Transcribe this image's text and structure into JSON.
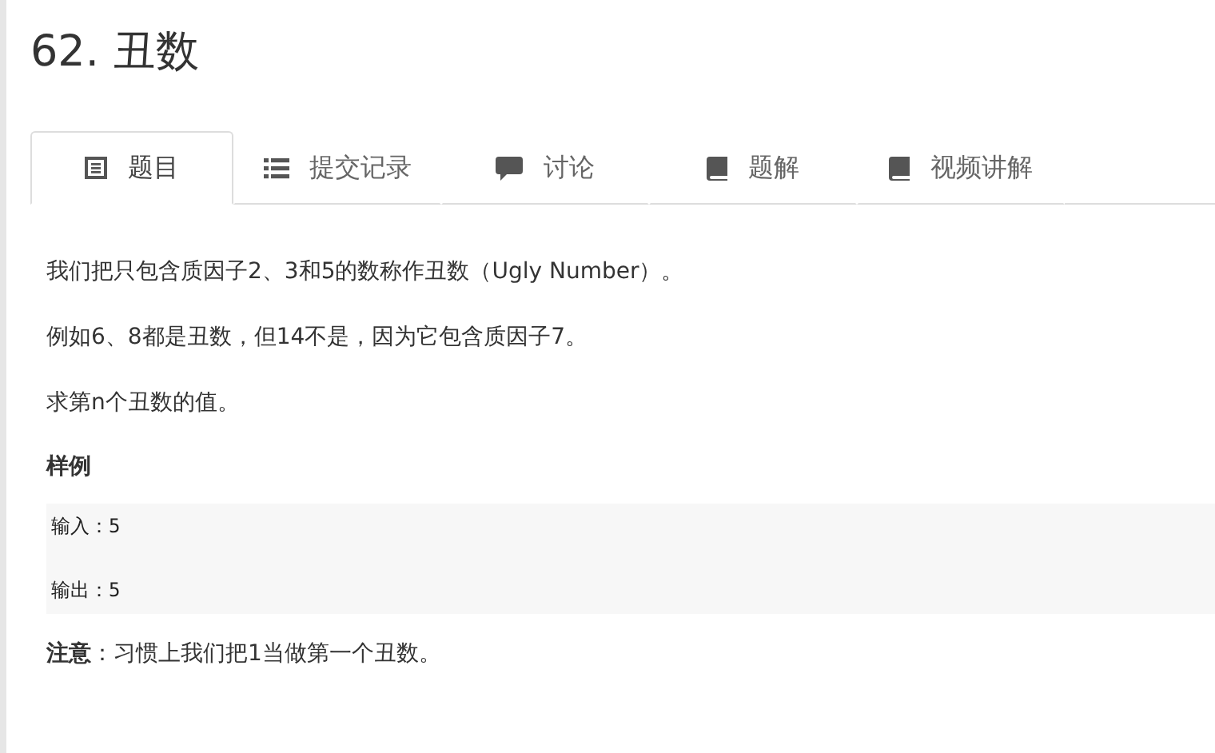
{
  "title": "62. 丑数",
  "tabs": [
    {
      "label": "题目",
      "kind": "doc",
      "selected": true
    },
    {
      "label": "提交记录",
      "kind": "list",
      "selected": false
    },
    {
      "label": "讨论",
      "kind": "comment",
      "selected": false
    },
    {
      "label": "题解",
      "kind": "book",
      "selected": false
    },
    {
      "label": "视频讲解",
      "kind": "book",
      "selected": false
    }
  ],
  "paragraphs": [
    "我们把只包含质因子2、3和5的数称作丑数（Ugly Number）。",
    "例如6、8都是丑数，但14不是，因为它包含质因子7。",
    "求第n个丑数的值。"
  ],
  "example_heading": "样例",
  "example_lines": [
    "输入：5",
    "输出：5"
  ],
  "note": "**注意**：习惯上我们把1当做第一个丑数。"
}
